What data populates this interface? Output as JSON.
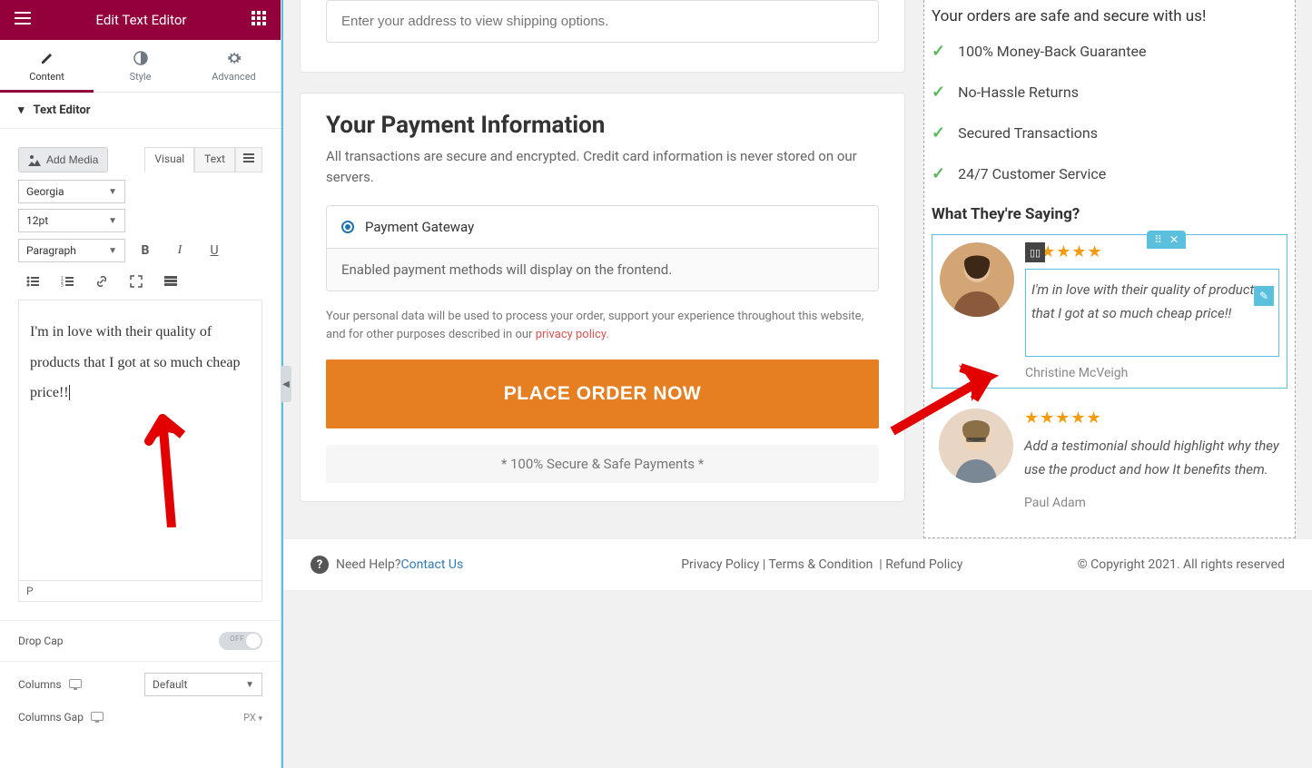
{
  "sidebar": {
    "title": "Edit Text Editor",
    "tabs": {
      "content": "Content",
      "style": "Style",
      "advanced": "Advanced"
    },
    "section_label": "Text Editor",
    "add_media": "Add Media",
    "editor_tabs": {
      "visual": "Visual",
      "text": "Text"
    },
    "font_select": "Georgia",
    "size_select": "12pt",
    "block_select": "Paragraph",
    "editor_text": "I'm in love with their quality of products that I got at so much cheap price!!",
    "status": "P",
    "drop_cap_label": "Drop Cap",
    "drop_cap_state": "OFF",
    "columns_label": "Columns",
    "columns_value": "Default",
    "columns_gap_label": "Columns Gap",
    "columns_gap_unit": "PX"
  },
  "checkout": {
    "address_placeholder": "Enter your address to view shipping options.",
    "payment_title": "Your Payment Information",
    "payment_sub": "All transactions are secure and encrypted. Credit card information is never stored on our servers.",
    "gateway_label": "Payment Gateway",
    "gateway_desc": "Enabled payment methods will display on the frontend.",
    "privacy_pre": "Your personal data will be used to process your order, support your experience throughout this website, and for other purposes described in our ",
    "privacy_link": "privacy policy",
    "place_order": "PLACE ORDER NOW",
    "secure_note": "* 100% Secure & Safe Payments *"
  },
  "trust": {
    "title": "Your orders are safe and secure with us!",
    "items": [
      "100% Money-Back Guarantee",
      "No-Hassle Returns",
      "Secured Transactions",
      "24/7 Customer Service"
    ]
  },
  "testimonials": {
    "title": "What They're Saying?",
    "list": [
      {
        "text": "I'm in love with their quality of products that I got at so much cheap price!!",
        "name": "Christine McVeigh"
      },
      {
        "text": "Add a testimonial should highlight why they use the product and how It benefits them.",
        "name": "Paul Adam"
      }
    ]
  },
  "footer": {
    "help_text": "Need Help? ",
    "contact": "Contact Us",
    "privacy": "Privacy Policy",
    "terms": "Terms & Condition",
    "refund": "Refund Policy",
    "copyright": "© Copyright 2021. All rights reserved"
  }
}
